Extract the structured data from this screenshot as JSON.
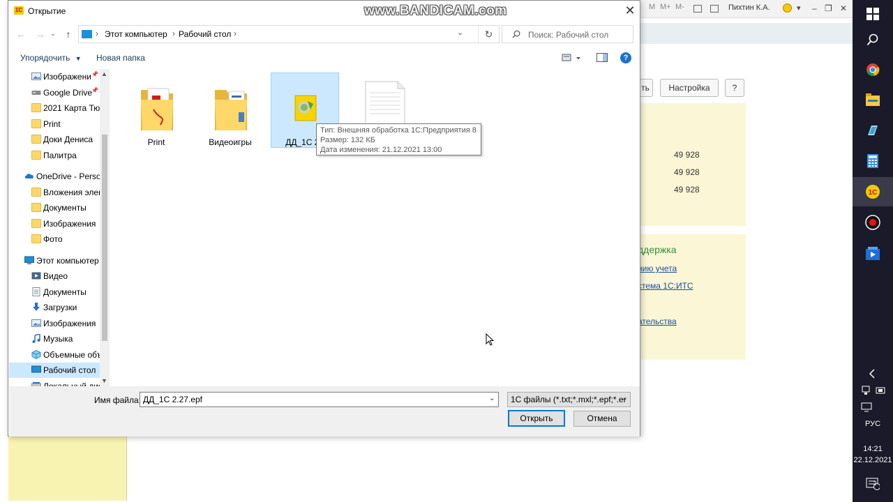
{
  "background_app": {
    "user": "Пихтин К.А.",
    "buttons": [
      "ть",
      "Настройка",
      "?"
    ],
    "values": [
      "49 928",
      "49 928",
      "49 928"
    ],
    "support_title": "ддержка",
    "links": [
      "нию учета",
      "стема 1С:ИТС",
      "ательства"
    ]
  },
  "taskbar": {
    "language": "РУС",
    "time": "14:21",
    "date": "22.12.2021",
    "notification_count": "2"
  },
  "watermark": "www.BANDICAM.com",
  "dialog": {
    "title": "Открытие",
    "address": {
      "parts": [
        "Этот компьютер",
        "Рабочий стол"
      ]
    },
    "search": {
      "placeholder": "Поиск: Рабочий стол"
    },
    "commands": {
      "organize": "Упорядочить",
      "new_folder": "Новая папка"
    },
    "nav": [
      {
        "label": "Изображени",
        "icon": "pictures-icon",
        "pinned": true
      },
      {
        "label": "Google Drive",
        "icon": "drive-icon",
        "pinned": true
      },
      {
        "label": "2021 Карта Тюм",
        "icon": "folder-icon"
      },
      {
        "label": "Print",
        "icon": "folder-icon"
      },
      {
        "label": "Доки Дениса",
        "icon": "folder-icon"
      },
      {
        "label": "Палитра",
        "icon": "folder-icon"
      },
      {
        "label": "OneDrive - Persor",
        "icon": "onedrive-icon"
      },
      {
        "label": "Вложения элект",
        "icon": "folder-icon"
      },
      {
        "label": "Документы",
        "icon": "folder-icon"
      },
      {
        "label": "Изображения",
        "icon": "folder-icon"
      },
      {
        "label": "Фото",
        "icon": "folder-icon"
      },
      {
        "label": "Этот компьютер",
        "icon": "computer-icon"
      },
      {
        "label": "Видео",
        "icon": "video-icon"
      },
      {
        "label": "Документы",
        "icon": "documents-icon"
      },
      {
        "label": "Загрузки",
        "icon": "download-icon"
      },
      {
        "label": "Изображения",
        "icon": "pictures-icon"
      },
      {
        "label": "Музыка",
        "icon": "music-icon"
      },
      {
        "label": "Объемные объ",
        "icon": "3d-objects-icon"
      },
      {
        "label": "Рабочий стол",
        "icon": "desktop-icon",
        "selected": true
      },
      {
        "label": "Локальный дис",
        "icon": "disk-icon"
      }
    ],
    "files": [
      {
        "label": "Print",
        "type": "folder"
      },
      {
        "label": "Видеоигры",
        "type": "folder"
      },
      {
        "label": "ДД_1С 2.",
        "type": "epf",
        "selected": true
      },
      {
        "label": "",
        "type": "document"
      }
    ],
    "tooltip": {
      "type_line": "Тип: Внешняя обработка 1С:Предприятия 8",
      "size_line": "Размер: 132 КБ",
      "date_line": "Дата изменения: 21.12.2021 13:00"
    },
    "filename_label": "Имя файла:",
    "filename_value": "ДД_1С 2.27.epf",
    "filter": "1С файлы (*.txt;*.mxl;*.epf;*.er",
    "open_button": "Открыть",
    "cancel_button": "Отмена"
  }
}
